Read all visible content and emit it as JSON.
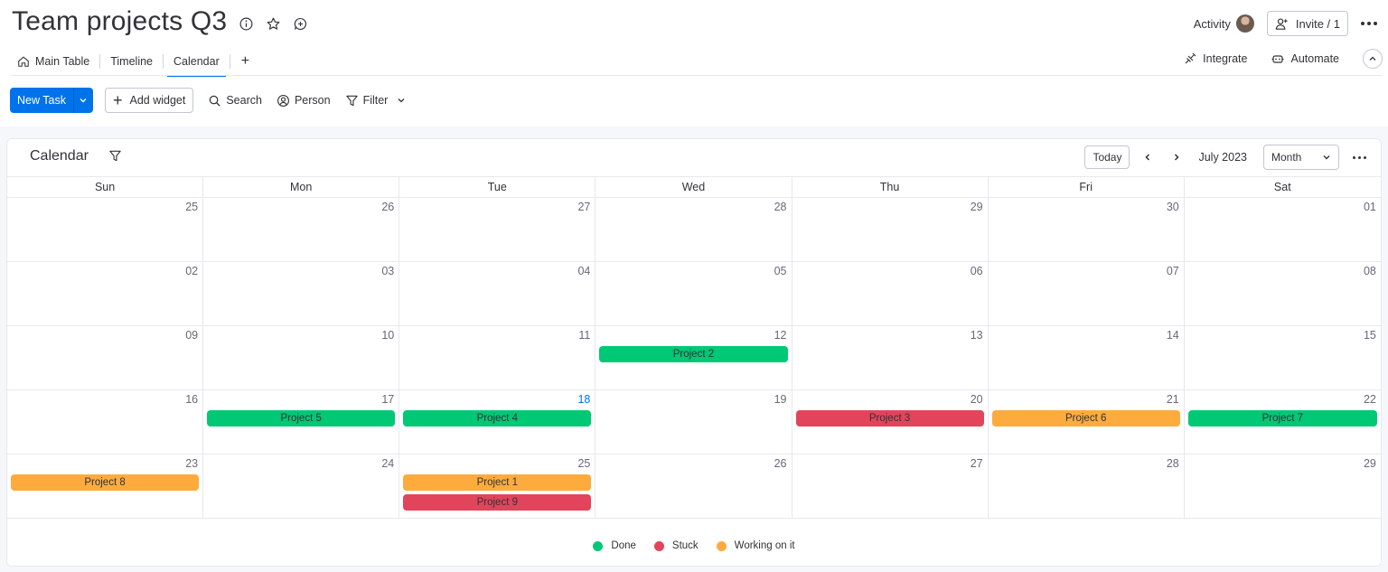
{
  "board": {
    "title": "Team projects Q3",
    "icons": [
      "info-icon",
      "star-icon",
      "chat-icon"
    ]
  },
  "header_right": {
    "activity_label": "Activity",
    "invite_label": "Invite / 1"
  },
  "tabs": [
    {
      "label": "Main Table",
      "icon": "home-icon",
      "active": false
    },
    {
      "label": "Timeline",
      "active": false
    },
    {
      "label": "Calendar",
      "active": true
    }
  ],
  "tabs_add": "+",
  "tabs_right": {
    "integrate_label": "Integrate",
    "automate_label": "Automate"
  },
  "toolbar": {
    "new_task_label": "New Task",
    "add_widget_label": "Add widget",
    "search_label": "Search",
    "person_label": "Person",
    "filter_label": "Filter"
  },
  "calendar": {
    "title": "Calendar",
    "today_label": "Today",
    "month_label": "July 2023",
    "view_label": "Month",
    "days_of_week": [
      "Sun",
      "Mon",
      "Tue",
      "Wed",
      "Thu",
      "Fri",
      "Sat"
    ],
    "today_date": "18",
    "weeks": [
      [
        "25",
        "26",
        "27",
        "28",
        "29",
        "30",
        "01"
      ],
      [
        "02",
        "03",
        "04",
        "05",
        "06",
        "07",
        "08"
      ],
      [
        "09",
        "10",
        "11",
        "12",
        "13",
        "14",
        "15"
      ],
      [
        "16",
        "17",
        "18",
        "19",
        "20",
        "21",
        "22"
      ],
      [
        "23",
        "24",
        "25",
        "26",
        "27",
        "28",
        "29"
      ]
    ],
    "events": [
      {
        "week": 2,
        "day": 3,
        "label": "Project 2",
        "status": "done"
      },
      {
        "week": 3,
        "day": 1,
        "label": "Project 5",
        "status": "done"
      },
      {
        "week": 3,
        "day": 2,
        "label": "Project 4",
        "status": "done"
      },
      {
        "week": 3,
        "day": 4,
        "label": "Project 3",
        "status": "stuck"
      },
      {
        "week": 3,
        "day": 5,
        "label": "Project 6",
        "status": "working"
      },
      {
        "week": 3,
        "day": 6,
        "label": "Project 7",
        "status": "done"
      },
      {
        "week": 4,
        "day": 0,
        "label": "Project 8",
        "status": "working"
      },
      {
        "week": 4,
        "day": 2,
        "label": "Project 1",
        "status": "working"
      },
      {
        "week": 4,
        "day": 2,
        "label": "Project 9",
        "status": "stuck"
      }
    ],
    "status_colors": {
      "done": "#00c875",
      "stuck": "#e2445c",
      "working": "#fdab3d"
    },
    "legend": [
      {
        "key": "done",
        "label": "Done"
      },
      {
        "key": "stuck",
        "label": "Stuck"
      },
      {
        "key": "working",
        "label": "Working on it"
      }
    ]
  }
}
